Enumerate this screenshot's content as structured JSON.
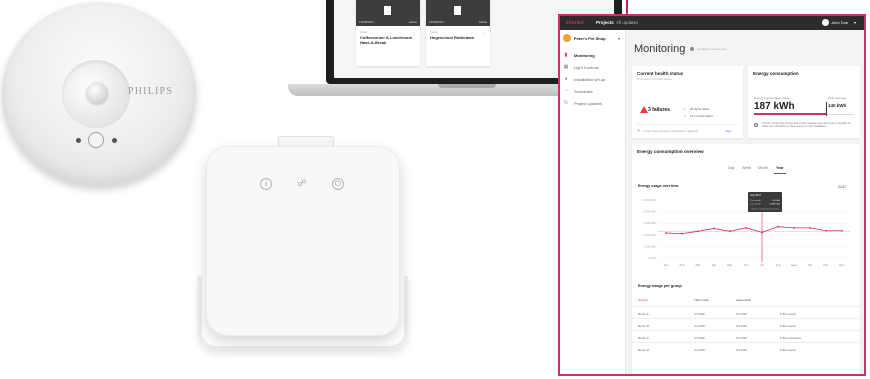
{
  "sensor": {
    "brand": "PHILIPS"
  },
  "laptop": {
    "cards": [
      {
        "date": "13/08/2017",
        "status": "Active",
        "small": "Food",
        "title": "Coffeecorner & Lunchroom Have-A-Break"
      },
      {
        "date": "13/08/2017",
        "status": "Active",
        "small": "Food",
        "title": "Hogeschool Rotterdam"
      }
    ]
  },
  "dashboard": {
    "topbar": {
      "logo": "interact",
      "nav": [
        "Projects",
        "All updates"
      ],
      "user": "John Doe"
    },
    "sidebar": {
      "project": "Peter's Pet Shop",
      "items": [
        {
          "label": "Monitoring",
          "icon": "bar-chart-icon"
        },
        {
          "label": "Light Controls",
          "icon": "grid-icon"
        },
        {
          "label": "Installation set-up",
          "icon": "pin-icon"
        },
        {
          "label": "Schedules",
          "icon": "clock-icon"
        },
        {
          "label": "Project updates",
          "icon": "refresh-icon"
        }
      ]
    },
    "page_title": "Monitoring",
    "updated": "Updated 1 minute ago",
    "health": {
      "title": "Current health status",
      "subtitle": "Overview of current status",
      "failures": "3 failures",
      "stats": [
        "28 lights failed",
        "10 controls failed"
      ],
      "last_request": "1 hour since previous connection to gateway",
      "view": "View"
    },
    "energy": {
      "title": "Energy consumption",
      "label_current": "Energy consumption today",
      "value": "187 kWh",
      "label_avg": "Daily average",
      "avg": "140 kWh",
      "tip": "You are using more energy than usual. Increase your dim level or consider to lower your schedules to save energy on your installation."
    },
    "overview": {
      "title": "Energy consumption overview",
      "tabs": [
        "Day",
        "Week",
        "Month",
        "Year"
      ],
      "active_tab": "Year",
      "chart_title": "Energy usage over time",
      "year": "2017",
      "tooltip": {
        "title": "July 2017",
        "row1_label": "This month",
        "row1_value": "3.4 kWh",
        "row2_label": "Last month",
        "row2_value": "3.490 kWh",
        "footer": "Click for complete year overview"
      }
    },
    "groups": {
      "title": "Energy usage per group",
      "headers": [
        "Groups",
        "This month",
        "Last month"
      ],
      "rows": [
        {
          "group": "Room A",
          "this": "3.5 kWh",
          "last": "3.5 kWh",
          "change": "0.3% saved"
        },
        {
          "group": "Room B",
          "this": "3.5 kWh",
          "last": "3.5 kWh",
          "change": "0.3% saved"
        },
        {
          "group": "Room C",
          "this": "3.5 kWh",
          "last": "3.5 kWh",
          "change": "0.3% increased"
        },
        {
          "group": "Room D",
          "this": "3.5 kWh",
          "last": "3.5 kWh",
          "change": "0.3% saved"
        }
      ]
    }
  },
  "chart_data": {
    "type": "line",
    "categories": [
      "Jan",
      "Feb",
      "Mar",
      "Apr",
      "May",
      "Jun",
      "Jul",
      "Aug",
      "Sept",
      "Oct",
      "Nov",
      "Dec"
    ],
    "series": [
      {
        "values": [
          4.3,
          4.2,
          4.6,
          5.1,
          4.6,
          5.2,
          4.4,
          5.4,
          5.2,
          5.2,
          4.7,
          4.7
        ]
      }
    ],
    "average": 4.6,
    "ylim": [
      0,
      10
    ],
    "yticks": [
      "10.000 kWh",
      "8.000 kWh",
      "6.000 kWh",
      "4.000 kWh",
      "2.000 kWh",
      "0 kWh"
    ],
    "highlight_category": "Jul",
    "colors": {
      "line": "#d42f63",
      "average": "#e87aa0",
      "marker": "#d42f63"
    }
  }
}
